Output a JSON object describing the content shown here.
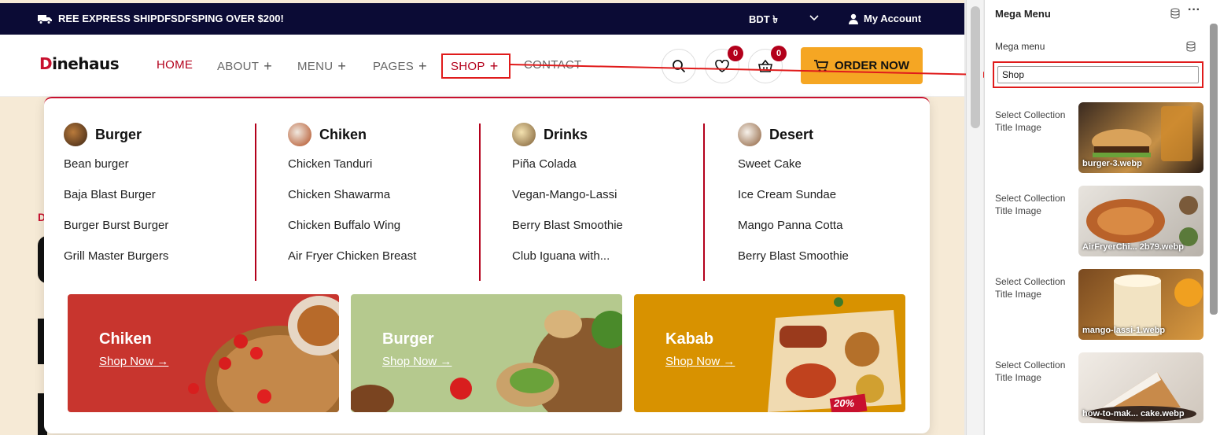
{
  "topbar": {
    "promo": "REE EXPRESS SHIPDFSDFSPING OVER $200!",
    "currency": "BDT ৳",
    "account": "My Account"
  },
  "brand": {
    "logo_first": "D",
    "logo_rest": "inehaus",
    "accent": "#c8102e"
  },
  "nav": {
    "items": [
      {
        "label": "HOME"
      },
      {
        "label": "ABOUT"
      },
      {
        "label": "MENU"
      },
      {
        "label": "PAGES"
      },
      {
        "label": "SHOP"
      },
      {
        "label": "CONTACT"
      }
    ],
    "plus": "+",
    "wishlist_count": "0",
    "cart_count": "0",
    "order_label": "ORDER NOW"
  },
  "mega": {
    "columns": [
      {
        "title": "Burger",
        "items": [
          "Bean burger",
          "Baja Blast Burger",
          "Burger Burst Burger",
          "Grill Master Burgers"
        ]
      },
      {
        "title": "Chiken",
        "items": [
          "Chicken Tanduri",
          "Chicken Shawarma",
          "Chicken Buffalo Wing",
          "Air Fryer Chicken Breast"
        ]
      },
      {
        "title": "Drinks",
        "items": [
          "Piña Colada",
          "Vegan-Mango-Lassi",
          "Berry Blast Smoothie",
          "Club Iguana with..."
        ]
      },
      {
        "title": "Desert",
        "items": [
          "Sweet Cake",
          "Ice Cream Sundae",
          "Mango Panna Cotta",
          "Berry Blast Smoothie"
        ]
      }
    ],
    "banners": [
      {
        "title": "Chiken",
        "link": "Shop Now",
        "color": "#c8352e"
      },
      {
        "title": "Burger",
        "link": "Shop Now",
        "color": "#b5c98e"
      },
      {
        "title": "Kabab",
        "link": "Shop Now",
        "color": "#d89200"
      }
    ],
    "discount_tag": "20%"
  },
  "background": {
    "side_letter": "D"
  },
  "sidebar": {
    "title": "Mega Menu",
    "field_label": "Mega menu",
    "field_value": "Shop",
    "collections": [
      {
        "label": "Select Collection Title Image",
        "file": "burger-3.webp"
      },
      {
        "label": "Select Collection Title Image",
        "file": "AirFryerChi... 2b79.webp"
      },
      {
        "label": "Select Collection Title Image",
        "file": "mango-lassi-1.webp"
      },
      {
        "label": "Select Collection Title Image",
        "file": "how-to-mak... cake.webp"
      }
    ]
  }
}
